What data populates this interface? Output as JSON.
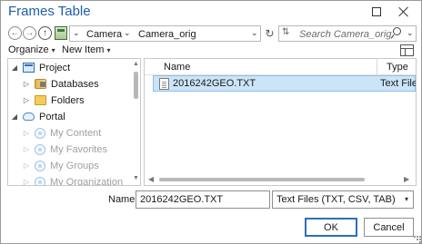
{
  "window": {
    "title": "Frames Table"
  },
  "address_bar": {
    "breadcrumbs": [
      "Camera",
      "Camera_orig"
    ]
  },
  "search": {
    "placeholder": "Search Camera_orig"
  },
  "toolbar": {
    "organize_label": "Organize",
    "new_item_label": "New Item"
  },
  "nav_tree": {
    "items": [
      {
        "label": "Project",
        "icon": "project-icon",
        "expander": "expanded",
        "enabled": true
      },
      {
        "label": "Databases",
        "icon": "database-icon",
        "expander": "collapsed",
        "enabled": true
      },
      {
        "label": "Folders",
        "icon": "folder-icon",
        "expander": "collapsed",
        "enabled": true
      },
      {
        "label": "Portal",
        "icon": "portal-icon",
        "expander": "expanded",
        "enabled": true
      },
      {
        "label": "My Content",
        "icon": "portal-content-icon",
        "expander": "collapsed",
        "enabled": false
      },
      {
        "label": "My Favorites",
        "icon": "portal-favorites-icon",
        "expander": "collapsed",
        "enabled": false
      },
      {
        "label": "My Groups",
        "icon": "portal-groups-icon",
        "expander": "collapsed",
        "enabled": false
      },
      {
        "label": "My Organization",
        "icon": "portal-organization-icon",
        "expander": "collapsed",
        "enabled": false
      }
    ]
  },
  "file_list": {
    "columns": [
      "Name",
      "Type"
    ],
    "rows": [
      {
        "name": "2016242GEO.TXT",
        "type": "Text File",
        "selected": true
      }
    ]
  },
  "footer": {
    "name_label": "Name",
    "name_value": "2016242GEO.TXT",
    "file_type_value": "Text Files (TXT, CSV, TAB)",
    "ok_label": "OK",
    "cancel_label": "Cancel"
  },
  "colors": {
    "title": "#1f5ea8",
    "selection_bg": "#cce4f7",
    "selection_border": "#8cc0ea",
    "default_button_border": "#2b6fb8"
  }
}
